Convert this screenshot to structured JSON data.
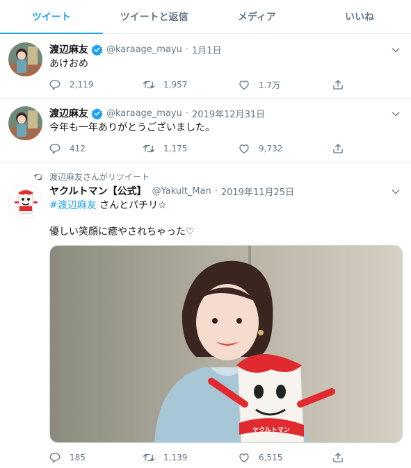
{
  "tabs": [
    {
      "label": "ツイート",
      "active": true
    },
    {
      "label": "ツイートと返信",
      "active": false
    },
    {
      "label": "メディア",
      "active": false
    },
    {
      "label": "いいね",
      "active": false
    }
  ],
  "tweets": [
    {
      "name": "渡辺麻友",
      "handle": "@karaage_mayu",
      "date": "1月1日",
      "text": "あけおめ",
      "replies": "2,119",
      "retweets": "1,957",
      "likes": "1.7万"
    },
    {
      "name": "渡辺麻友",
      "handle": "@karaage_mayu",
      "date": "2019年12月31日",
      "text": "今年も一年ありがとうございました。",
      "replies": "412",
      "retweets": "1,175",
      "likes": "9,732"
    },
    {
      "retweet_label": "渡辺麻友さんがリツイート",
      "name": "ヤクルトマン【公式】",
      "handle": "@Yakult_Man",
      "date": "2019年11月25日",
      "hashtag": "#渡辺麻友",
      "text_line1": " さんとパチリ☆",
      "text_line2": "優しい笑顔に癒やされちゃった♡",
      "replies": "185",
      "retweets": "1,139",
      "likes": "6,515",
      "mascot_sign": "ヤクルトマン"
    }
  ],
  "colors": {
    "accent": "#1da1f2",
    "muted": "#657786",
    "border": "#e6ecf0",
    "yakult_red": "#e02a2f"
  }
}
